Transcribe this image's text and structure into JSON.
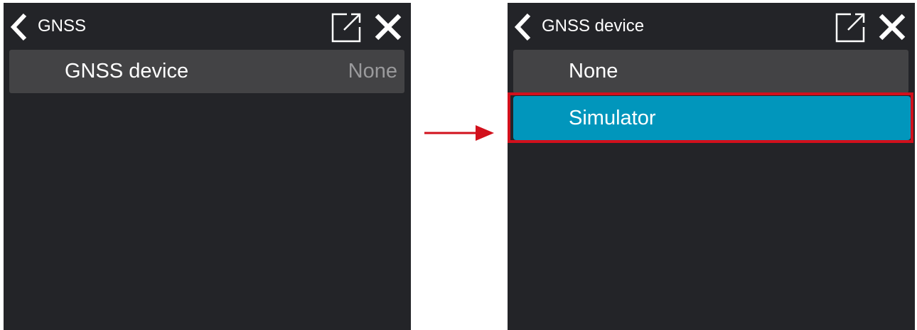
{
  "left_screen": {
    "header": {
      "title": "GNSS"
    },
    "rows": [
      {
        "label": "GNSS device",
        "value": "None"
      }
    ]
  },
  "right_screen": {
    "header": {
      "title": "GNSS device"
    },
    "options": [
      {
        "label": "None",
        "selected": false
      },
      {
        "label": "Simulator",
        "selected": true
      }
    ]
  },
  "colors": {
    "panel_background": "#232428",
    "row_background": "#434345",
    "selected_row": "#0196bc",
    "highlight": "#d2101c",
    "value_text": "#9a9a9c"
  },
  "icons": [
    "back-icon",
    "popout-icon",
    "close-icon",
    "right-arrow-icon"
  ]
}
